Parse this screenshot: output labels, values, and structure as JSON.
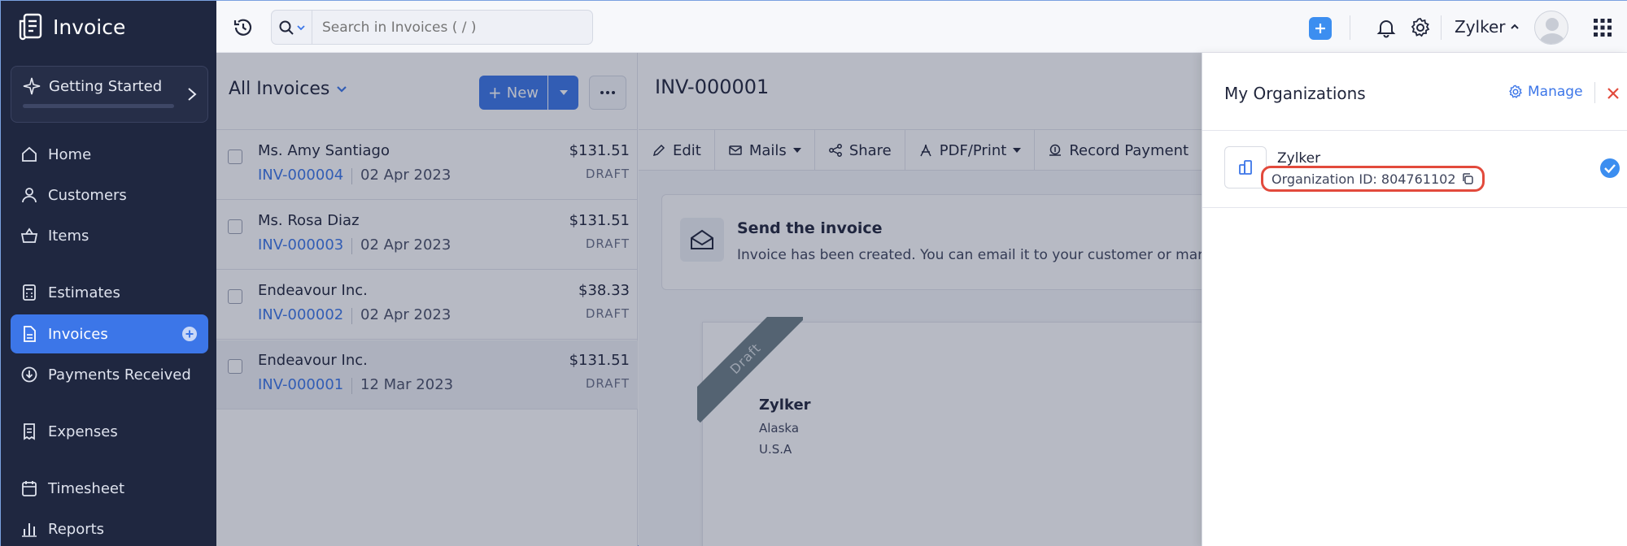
{
  "app": {
    "title": "Invoice"
  },
  "sidebar": {
    "getting_started": "Getting Started",
    "items": [
      {
        "label": "Home",
        "icon": "home-icon"
      },
      {
        "label": "Customers",
        "icon": "user-icon"
      },
      {
        "label": "Items",
        "icon": "basket-icon"
      },
      {
        "label": "Estimates",
        "icon": "calculator-icon"
      },
      {
        "label": "Invoices",
        "icon": "document-icon",
        "active": true
      },
      {
        "label": "Payments Received",
        "icon": "payment-icon"
      },
      {
        "label": "Expenses",
        "icon": "receipt-icon"
      },
      {
        "label": "Timesheet",
        "icon": "calendar-icon"
      },
      {
        "label": "Reports",
        "icon": "bar-chart-icon"
      }
    ]
  },
  "topbar": {
    "search_placeholder": "Search in Invoices ( / )",
    "org_name": "Zylker"
  },
  "list": {
    "title": "All Invoices",
    "new_label": "New",
    "rows": [
      {
        "customer": "Ms. Amy Santiago",
        "number": "INV-000004",
        "date": "02 Apr 2023",
        "amount": "$131.51",
        "status": "DRAFT"
      },
      {
        "customer": "Ms. Rosa Diaz",
        "number": "INV-000003",
        "date": "02 Apr 2023",
        "amount": "$131.51",
        "status": "DRAFT"
      },
      {
        "customer": "Endeavour Inc.",
        "number": "INV-000002",
        "date": "02 Apr 2023",
        "amount": "$38.33",
        "status": "DRAFT"
      },
      {
        "customer": "Endeavour Inc.",
        "number": "INV-000001",
        "date": "12 Mar 2023",
        "amount": "$131.51",
        "status": "DRAFT"
      }
    ]
  },
  "detail": {
    "title": "INV-000001",
    "actions": {
      "edit": "Edit",
      "mails": "Mails",
      "share": "Share",
      "pdf": "PDF/Print",
      "record": "Record Payment"
    },
    "send_title": "Send the invoice",
    "send_desc": "Invoice has been created. You can email it to your customer or mark it",
    "ribbon": "Draft",
    "org_name": "Zylker",
    "address_line1": "Alaska",
    "address_line2": "U.S.A"
  },
  "org_panel": {
    "title": "My Organizations",
    "manage": "Manage",
    "org_name": "Zylker",
    "org_id": "Organization ID: 804761102"
  },
  "colors": {
    "accent": "#3c76e8",
    "sidebar": "#1f2740",
    "highlight": "#e24a3c"
  }
}
